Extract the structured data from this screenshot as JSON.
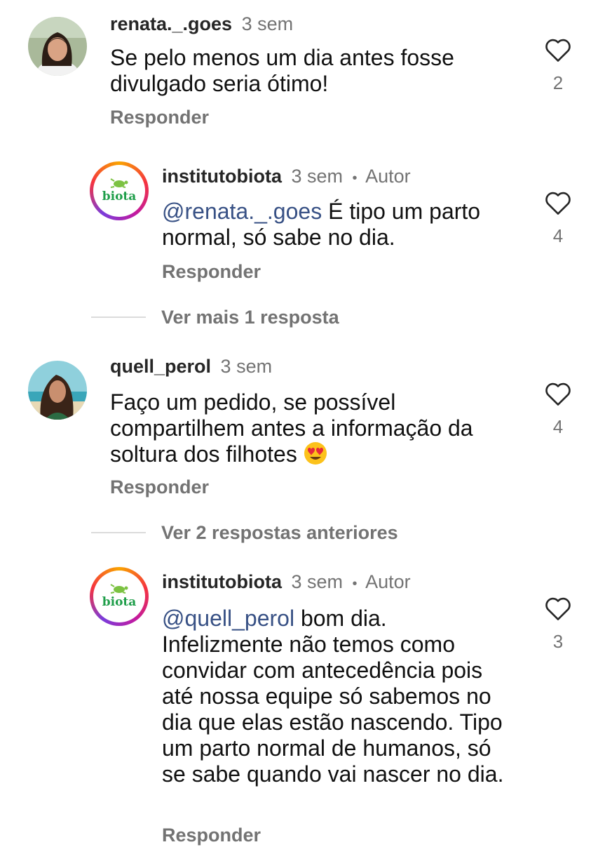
{
  "comments": [
    {
      "username": "renata._.goes",
      "time": "3 sem",
      "text": "Se pelo menos um dia antes fosse divulgado seria ótimo!",
      "reply_label": "Responder",
      "likes": "2"
    },
    {
      "username": "institutobiota",
      "time": "3 sem",
      "separator": "•",
      "author_badge": "Autor",
      "avatar_text": "biota",
      "mention": "@renata._.goes",
      "text": " É tipo um parto normal, só sabe no dia.",
      "reply_label": "Responder",
      "likes": "4"
    },
    {
      "more_replies": "Ver mais 1 resposta"
    },
    {
      "username": "quell_perol",
      "time": "3 sem",
      "text": "Faço um pedido, se possível compartilhem antes a informação da soltura dos filhotes",
      "emoji": "heart-eyes",
      "reply_label": "Responder",
      "likes": "4"
    },
    {
      "more_replies": "Ver 2 respostas anteriores"
    },
    {
      "username": "institutobiota",
      "time": "3 sem",
      "separator": "•",
      "author_badge": "Autor",
      "avatar_text": "biota",
      "mention": "@quell_perol",
      "text": " bom dia. Infelizmente não temos como convidar com antecedência pois até nossa equipe só sabemos no dia que elas estão nascendo. Tipo um parto normal de humanos, só se sabe quando vai nascer no dia.",
      "reply_label": "Responder",
      "likes": "3"
    }
  ],
  "colors": {
    "username": "#262626",
    "meta": "#737373",
    "mention": "#385185",
    "divider": "#dbdbdb",
    "brand_green": "#1f9e4a"
  }
}
